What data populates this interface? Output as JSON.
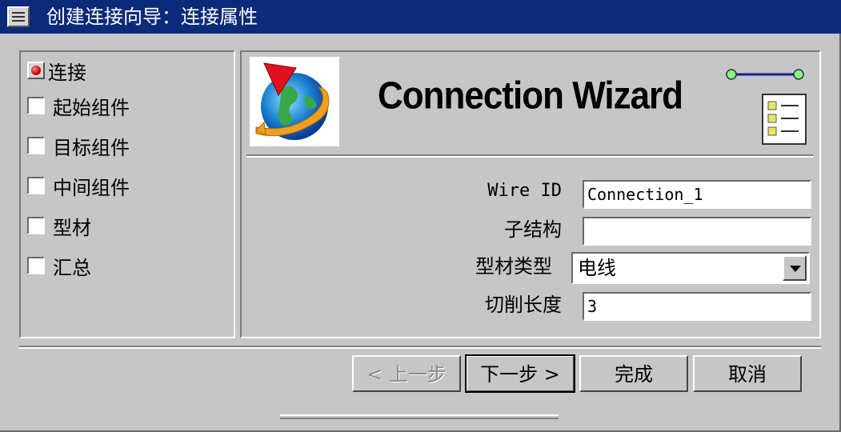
{
  "window": {
    "title": "创建连接向导：连接属性"
  },
  "steps": [
    {
      "label": "连接",
      "state": "current"
    },
    {
      "label": "起始组件",
      "state": "pending"
    },
    {
      "label": "目标组件",
      "state": "pending"
    },
    {
      "label": "中间组件",
      "state": "pending"
    },
    {
      "label": "型材",
      "state": "pending"
    },
    {
      "label": "汇总",
      "state": "pending"
    }
  ],
  "header": {
    "title": "Connection Wizard",
    "logo_icon": "globe-arrow-icon",
    "connection_icon": "wire-connection-icon",
    "checklist_icon": "checklist-icon"
  },
  "form": {
    "wire_id": {
      "label": "Wire ID",
      "value": "Connection_1"
    },
    "substructure": {
      "label": "子结构",
      "value": ""
    },
    "profile_type": {
      "label": "型材类型",
      "value": "电线"
    },
    "cut_length": {
      "label": "切削长度",
      "value": "3"
    }
  },
  "buttons": {
    "back": "< 上一步",
    "next": "下一步 >",
    "finish": "完成",
    "cancel": "取消"
  },
  "colors": {
    "titlebar": "#0b2a7a",
    "window": "#c6c6c6",
    "wire_line": "#1a1aa0",
    "wire_node": "#80ff80"
  }
}
